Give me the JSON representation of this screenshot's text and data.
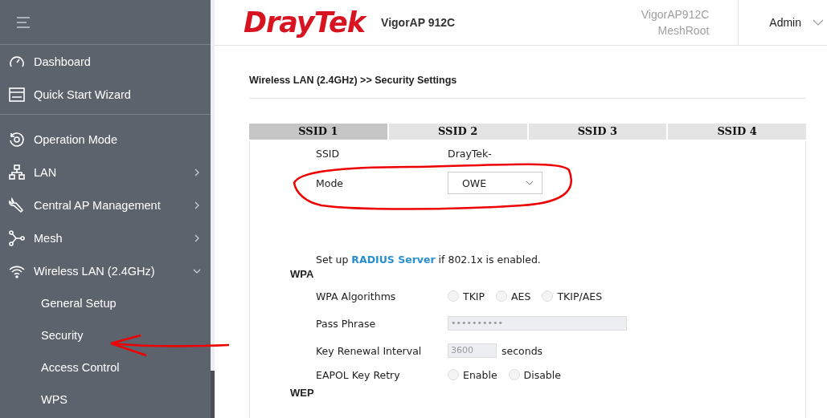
{
  "header": {
    "logo": "DrayTek",
    "model": "VigorAP 912C",
    "device_name": "VigorAP912C",
    "mesh_role": "MeshRoot",
    "user": "Admin"
  },
  "sidebar": {
    "groups": [
      [
        {
          "label": "Dashboard"
        },
        {
          "label": "Quick Start Wizard"
        }
      ],
      [
        {
          "label": "Operation Mode"
        },
        {
          "label": "LAN",
          "expanded": false
        },
        {
          "label": "Central AP Management",
          "expanded": false
        },
        {
          "label": "Mesh",
          "expanded": false
        },
        {
          "label": "Wireless LAN (2.4GHz)",
          "expanded": true,
          "children": [
            {
              "label": "General Setup"
            },
            {
              "label": "Security"
            },
            {
              "label": "Access Control"
            },
            {
              "label": "WPS"
            }
          ]
        }
      ]
    ]
  },
  "breadcrumb": "Wireless LAN (2.4GHz) >> Security Settings",
  "tabs": [
    {
      "label": "SSID 1",
      "selected": true
    },
    {
      "label": "SSID 2",
      "selected": false
    },
    {
      "label": "SSID 3",
      "selected": false
    },
    {
      "label": "SSID 4",
      "selected": false
    }
  ],
  "form": [
    {
      "kind": "text",
      "label": "SSID",
      "value": "DrayTek-"
    },
    {
      "kind": "select",
      "label": "Mode",
      "value": "OWE"
    },
    {
      "kind": "note",
      "before": "Set up",
      "link": "RADIUS Server",
      "after": "if 802.1x is enabled."
    },
    {
      "kind": "section",
      "label": "WPA"
    },
    {
      "kind": "radio",
      "label": "WPA Algorithms",
      "options": [
        {
          "label": "TKIP",
          "selected": false
        },
        {
          "label": "AES",
          "selected": false
        },
        {
          "label": "TKIP/AES",
          "selected": false
        }
      ]
    },
    {
      "kind": "password",
      "label": "Pass Phrase",
      "value": "••••••••••",
      "disabled": true
    },
    {
      "kind": "number",
      "label": "Key Renewal Interval",
      "value": "3600",
      "unit": "seconds",
      "disabled": true
    },
    {
      "kind": "radio",
      "label": "EAPOL Key Retry",
      "options": [
        {
          "label": "Enable",
          "selected": false
        },
        {
          "label": "Disable",
          "selected": false
        }
      ]
    },
    {
      "kind": "section",
      "label": "WEP"
    }
  ]
}
